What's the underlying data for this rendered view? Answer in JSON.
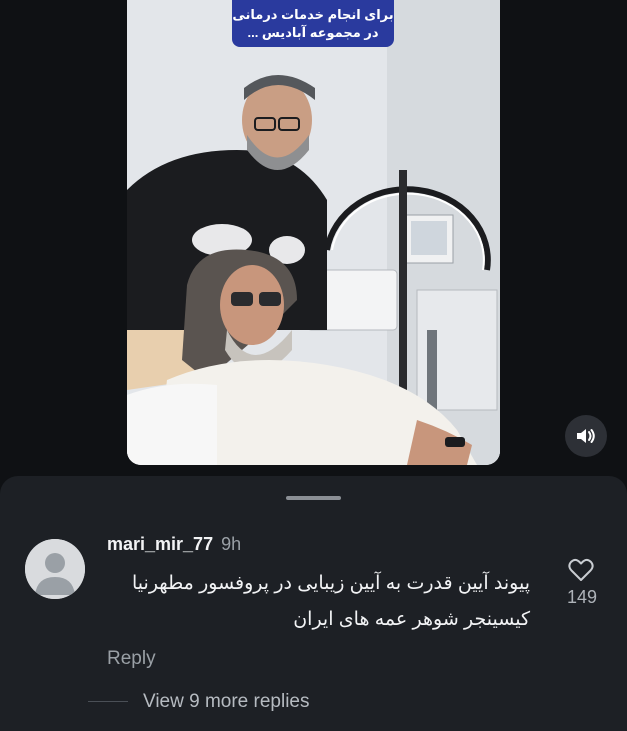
{
  "video": {
    "caption_line1": "برای انجام خدمات درمانی",
    "caption_line2": "در مجموعه آبادیس ...",
    "mute_icon": "speaker-icon"
  },
  "comment": {
    "username": "mari_mir_77",
    "timestamp": "9h",
    "text_line1": "پیوند آیین قدرت به آیین زیبایی در پروفسور مطهرنیا",
    "text_line2": "کیسینجر شوهر عمه های ایران",
    "like_icon": "heart-icon",
    "like_count": "149",
    "reply_label": "Reply",
    "view_replies_label": "View 9 more replies"
  },
  "colors": {
    "background": "#0f1114",
    "sheet": "#1d2025",
    "caption_bg": "#2a3a9e",
    "muted_text": "#9aa0a6"
  }
}
